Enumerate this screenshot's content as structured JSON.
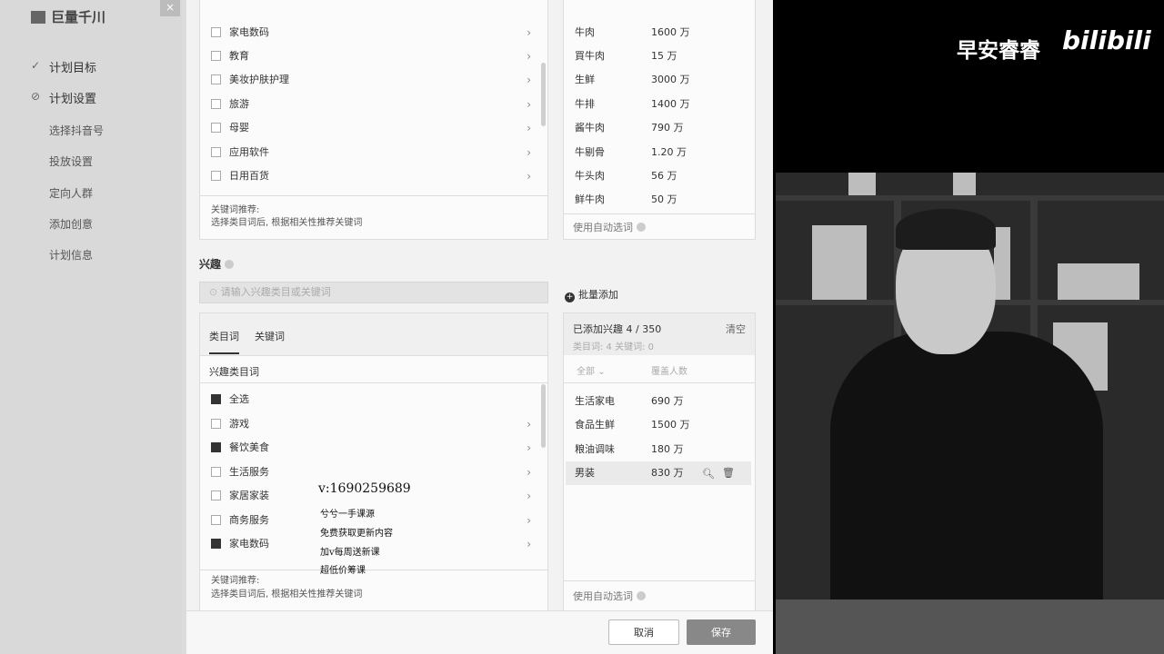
{
  "app": {
    "brand": "巨量千川",
    "close": "×"
  },
  "nav": {
    "items": [
      {
        "label": "计划目标",
        "bullet": "✓"
      },
      {
        "label": "计划设置",
        "bullet": "⊘"
      },
      {
        "label": "选择抖音号"
      },
      {
        "label": "投放设置"
      },
      {
        "label": "定向人群"
      },
      {
        "label": "添加创意"
      },
      {
        "label": "计划信息"
      }
    ]
  },
  "industry_list": {
    "items": [
      {
        "label": "家电数码"
      },
      {
        "label": "教育"
      },
      {
        "label": "美妆护肤护理"
      },
      {
        "label": "旅游"
      },
      {
        "label": "母婴"
      },
      {
        "label": "应用软件"
      },
      {
        "label": "日用百货"
      }
    ],
    "hint_title": "关键词推荐:",
    "hint_body": "选择类目词后, 根据相关性推荐关键词"
  },
  "keywords_top": {
    "rows": [
      {
        "word": "牛肉",
        "count": "1600 万"
      },
      {
        "word": "買牛肉",
        "count": "15 万"
      },
      {
        "word": "生鲜",
        "count": "3000 万"
      },
      {
        "word": "牛排",
        "count": "1400 万"
      },
      {
        "word": "酱牛肉",
        "count": "790 万"
      },
      {
        "word": "牛剔骨",
        "count": "1.20 万"
      },
      {
        "word": "牛头肉",
        "count": "56 万"
      },
      {
        "word": "鲜牛肉",
        "count": "50 万"
      }
    ],
    "footer": "使用自动选词"
  },
  "interest": {
    "title": "兴趣",
    "search_placeholder": "请输入兴趣类目或关键词",
    "batch_add": "批量添加",
    "tabs": [
      "类目词",
      "关键词"
    ],
    "category_header": "兴趣类目词",
    "categories": [
      {
        "label": "全选",
        "checked": true,
        "chevron": false
      },
      {
        "label": "游戏",
        "checked": false,
        "chevron": true
      },
      {
        "label": "餐饮美食",
        "checked": true,
        "chevron": true
      },
      {
        "label": "生活服务",
        "checked": false,
        "chevron": true
      },
      {
        "label": "家居家装",
        "checked": false,
        "chevron": true
      },
      {
        "label": "商务服务",
        "checked": false,
        "chevron": true
      },
      {
        "label": "家电数码",
        "checked": true,
        "chevron": true
      }
    ],
    "hint_title": "关键词推荐:",
    "hint_body": "选择类目词后, 根据相关性推荐关键词",
    "added": {
      "title": "已添加兴趣 4 / 350",
      "clear": "清空",
      "subtitle": "类目词: 4  关键词: 0",
      "filter_all": "全部",
      "col_reach": "覆盖人数",
      "rows": [
        {
          "word": "生活家电",
          "count": "690 万"
        },
        {
          "word": "食品生鲜",
          "count": "1500 万"
        },
        {
          "word": "粮油调味",
          "count": "180 万"
        },
        {
          "word": "男装",
          "count": "830 万"
        }
      ],
      "footer": "使用自动选词"
    }
  },
  "footer": {
    "cancel": "取消",
    "save": "保存"
  },
  "overlay": {
    "contact": "v:1690259689",
    "line1": "兮兮一手课源",
    "line2": "免费获取更新内容",
    "line3": "加v每周送新课",
    "line4": "超低价筹课"
  },
  "video": {
    "channel": "早安睿睿",
    "logo": "bilibili"
  },
  "icons": {
    "search": "search-icon",
    "delete": "trash-icon",
    "chevron": "chevron-right-icon"
  }
}
